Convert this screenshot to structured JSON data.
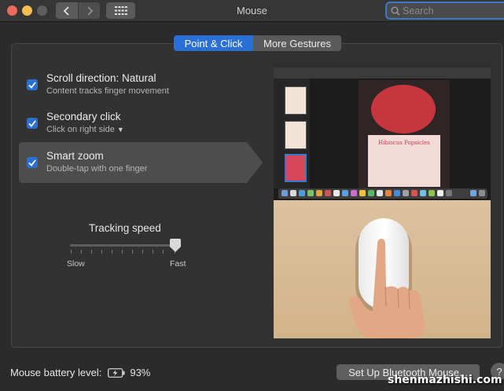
{
  "window": {
    "title": "Mouse"
  },
  "toolbar": {
    "back_icon": "chevron-left-icon",
    "forward_icon": "chevron-right-icon",
    "grid_icon": "grid-icon",
    "search_placeholder": "Search"
  },
  "tabs": [
    {
      "label": "Point & Click",
      "active": true
    },
    {
      "label": "More Gestures",
      "active": false
    }
  ],
  "options": [
    {
      "title": "Scroll direction: Natural",
      "subtitle": "Content tracks finger movement",
      "checked": true
    },
    {
      "title": "Secondary click",
      "subtitle": "Click on right side",
      "checked": true,
      "has_dropdown": true
    },
    {
      "title": "Smart zoom",
      "subtitle": "Double-tap with one finger",
      "checked": true,
      "selected": true
    }
  ],
  "tracking": {
    "label": "Tracking speed",
    "min_label": "Slow",
    "max_label": "Fast",
    "value": 1.0
  },
  "preview": {
    "doc_title": "Hibiscus Popsicles"
  },
  "footer": {
    "battery_label": "Mouse battery level:",
    "battery_value": "93%",
    "setup_button": "Set Up Bluetooth Mouse...",
    "help_label": "?"
  },
  "watermark": "shenmazhishi.com",
  "colors": {
    "accent": "#2a6fd6",
    "background": "#2b2b2b"
  }
}
